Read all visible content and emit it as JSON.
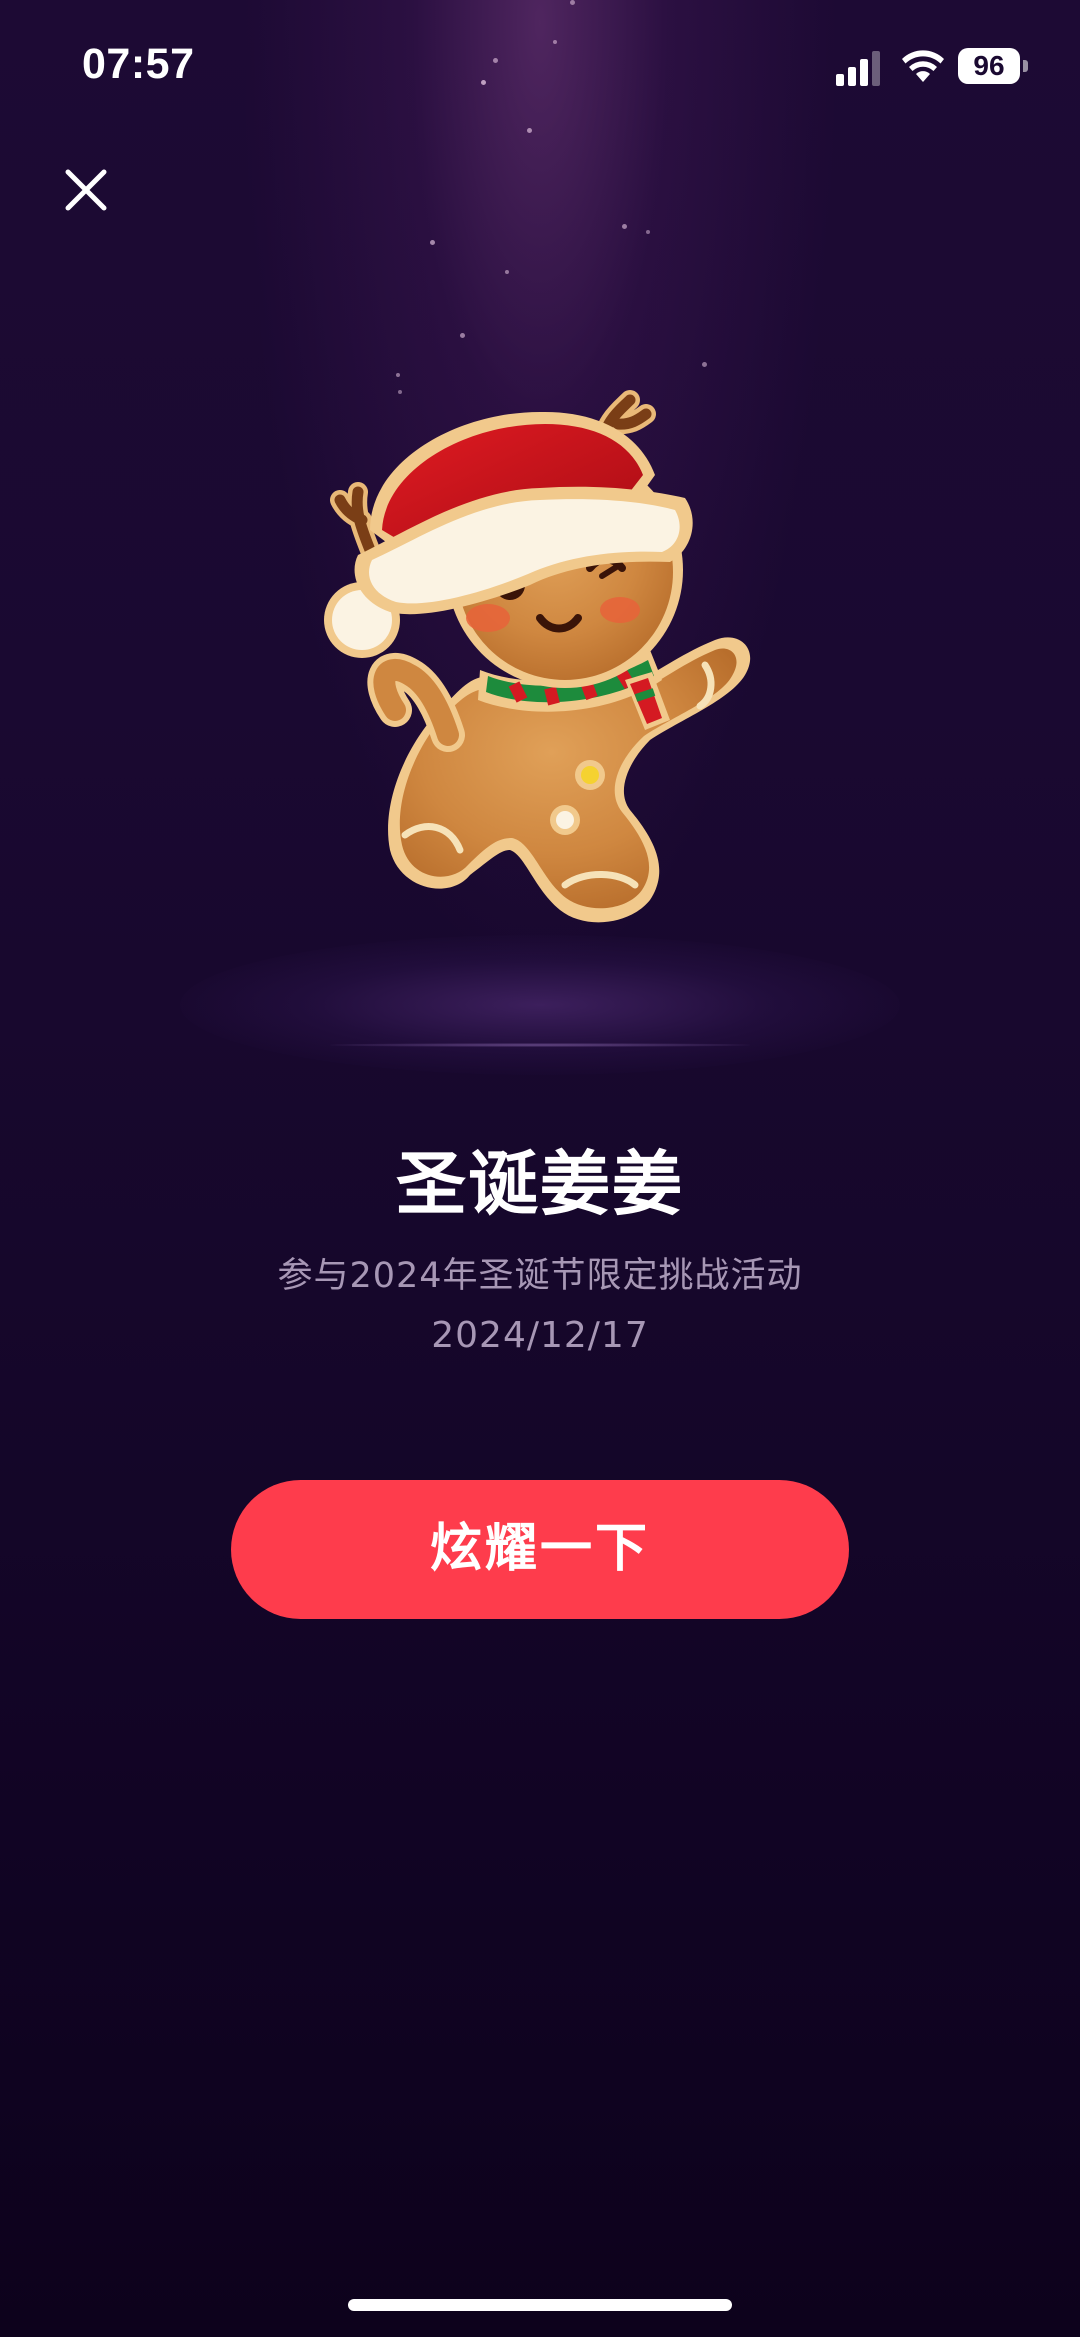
{
  "status_bar": {
    "time": "07:57",
    "battery_level": "96",
    "icons": [
      "signal-icon",
      "wifi-icon",
      "battery-icon"
    ]
  },
  "header": {
    "close_icon": "close-icon"
  },
  "badge": {
    "icon": "gingerbread-man-icon",
    "title": "圣诞姜姜",
    "description": "参与2024年圣诞节限定挑战活动",
    "date": "2024/12/17"
  },
  "action": {
    "button_label": "炫耀一下"
  },
  "colors": {
    "background": "#1a0931",
    "accent": "#fe3c4c",
    "secondary_text": "#a797b5"
  }
}
